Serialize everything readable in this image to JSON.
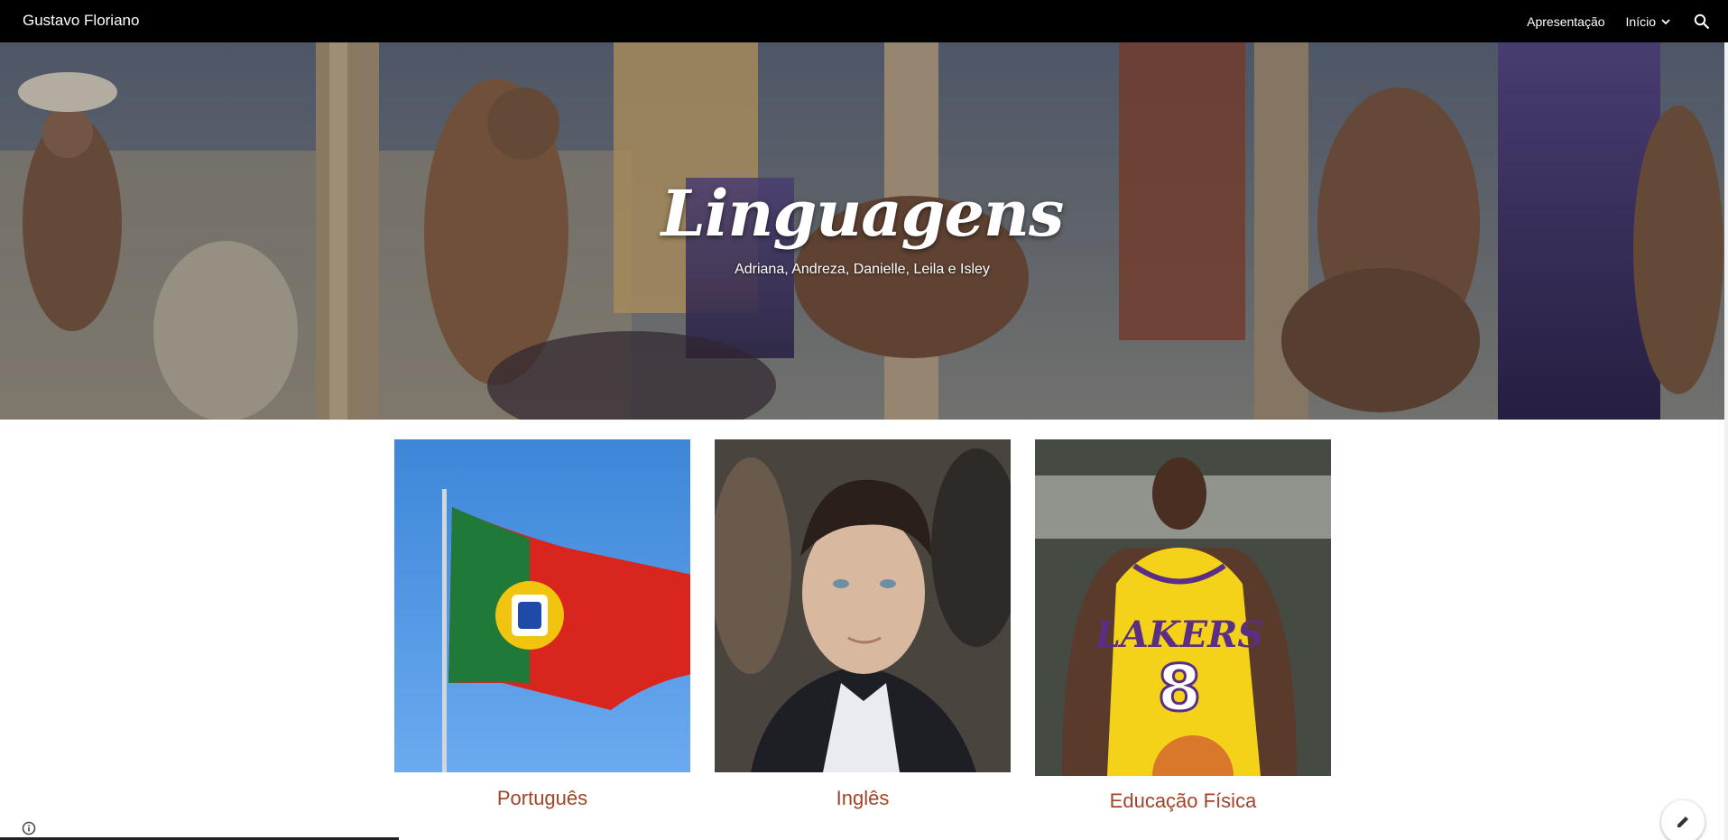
{
  "header": {
    "site_title": "Gustavo Floriano",
    "nav": [
      {
        "label": "Apresentação"
      },
      {
        "label": "Início",
        "has_dropdown": true
      }
    ],
    "search_icon": "search-icon"
  },
  "hero": {
    "title": "Linguagens",
    "subtitle": "Adriana, Andreza, Danielle, Leila e Isley"
  },
  "cards": [
    {
      "caption": "Português",
      "image": "portugal-flag"
    },
    {
      "caption": "Inglês",
      "image": "man-portrait"
    },
    {
      "caption": "Educação Física",
      "image": "basketball-player"
    }
  ],
  "colors": {
    "topbar": "#000000",
    "caption": "#a0442a"
  }
}
